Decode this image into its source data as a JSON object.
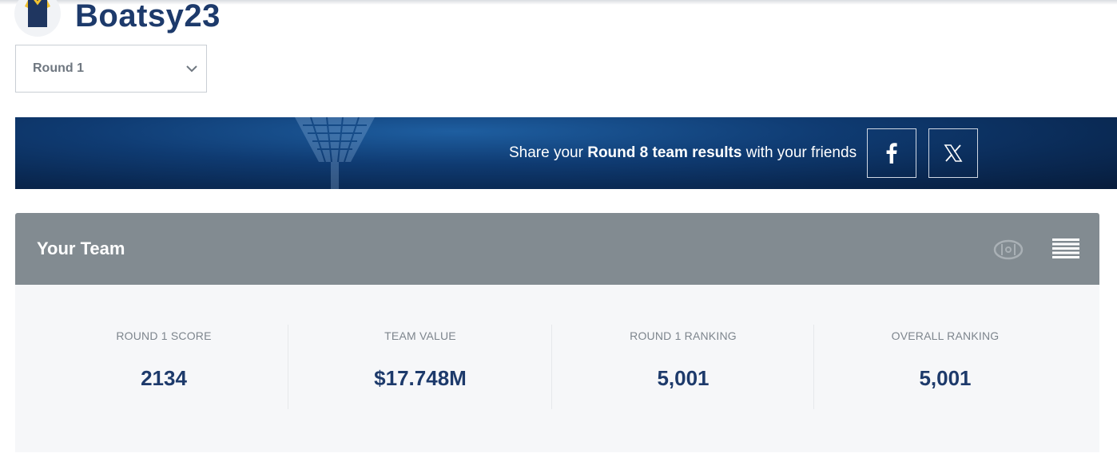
{
  "header": {
    "username": "Boatsy23",
    "avatar_icon": "jersey-icon"
  },
  "round_select": {
    "selected": "Round 1",
    "icon": "chevron-down-icon"
  },
  "share_banner": {
    "prefix": "Share your ",
    "highlight": "Round 8 team results",
    "suffix": " with your friends",
    "facebook_icon": "facebook-icon",
    "x_icon": "x-icon"
  },
  "team": {
    "title": "Your Team",
    "field_view_icon": "field-view-icon",
    "list_view_icon": "list-view-icon"
  },
  "stats": [
    {
      "label": "ROUND 1 SCORE",
      "value": "2134"
    },
    {
      "label": "TEAM VALUE",
      "value": "$17.748M"
    },
    {
      "label": "ROUND 1 RANKING",
      "value": "5,001"
    },
    {
      "label": "OVERALL RANKING",
      "value": "5,001"
    }
  ],
  "colors": {
    "brand_navy": "#1d3a6b",
    "team_bar": "#828b91",
    "stats_bg": "#f6f7f9",
    "banner": "#0f3b72"
  }
}
